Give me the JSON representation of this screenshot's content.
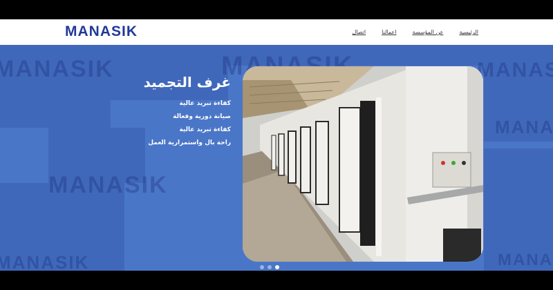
{
  "brand": {
    "logo": "MANASIK",
    "color": "#22399a"
  },
  "nav": {
    "items": [
      {
        "label": "اتصال"
      },
      {
        "label": "اعمالنا"
      },
      {
        "label": "عن المؤسسة"
      },
      {
        "label": "الرئيسية"
      }
    ]
  },
  "hero": {
    "title": "غرف التجميد",
    "features": [
      "كفاءة تبريد عالية",
      "صيانة دورية وفعالة",
      "كفاءة تبريد عالية",
      "راحة بال واستمرارية العمل"
    ],
    "background_color": "#4a76c8",
    "watermark_text": "MANASIK"
  },
  "carousel": {
    "active_index": 2,
    "count": 3
  }
}
